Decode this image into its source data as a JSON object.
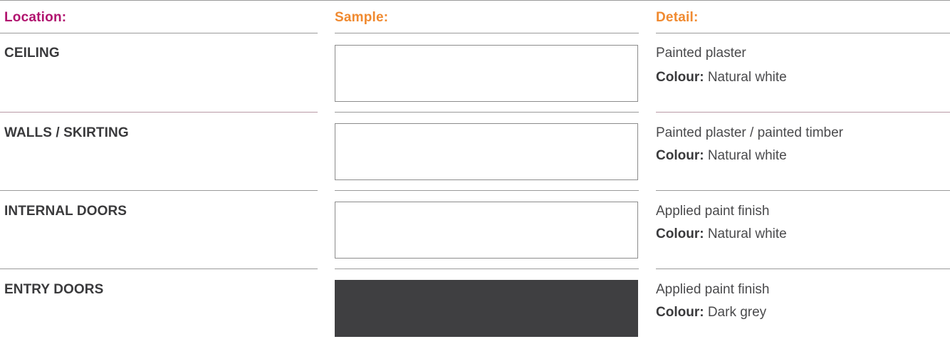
{
  "headers": {
    "location": "Location:",
    "sample": "Sample:",
    "detail": "Detail:"
  },
  "colours": {
    "location_header": "#b1146f",
    "sample_header": "#f08a30",
    "detail_header": "#f08a30",
    "rule_light": "#9a9a9a",
    "rule_mauve": "#b89aa6"
  },
  "rows": [
    {
      "location": "CEILING",
      "sample_colour": "#ffffff",
      "detail": "Painted plaster",
      "colour_label": "Colour:",
      "colour_value": "Natural white"
    },
    {
      "location": "WALLS / SKIRTING",
      "sample_colour": "#ffffff",
      "detail": "Painted plaster / painted timber",
      "colour_label": "Colour:",
      "colour_value": "Natural white"
    },
    {
      "location": "INTERNAL DOORS",
      "sample_colour": "#ffffff",
      "detail": "Applied paint finish",
      "colour_label": "Colour:",
      "colour_value": "Natural white"
    },
    {
      "location": "ENTRY DOORS",
      "sample_colour": "#3f3f41",
      "detail": "Applied paint finish",
      "colour_label": "Colour:",
      "colour_value": "Dark grey"
    }
  ]
}
